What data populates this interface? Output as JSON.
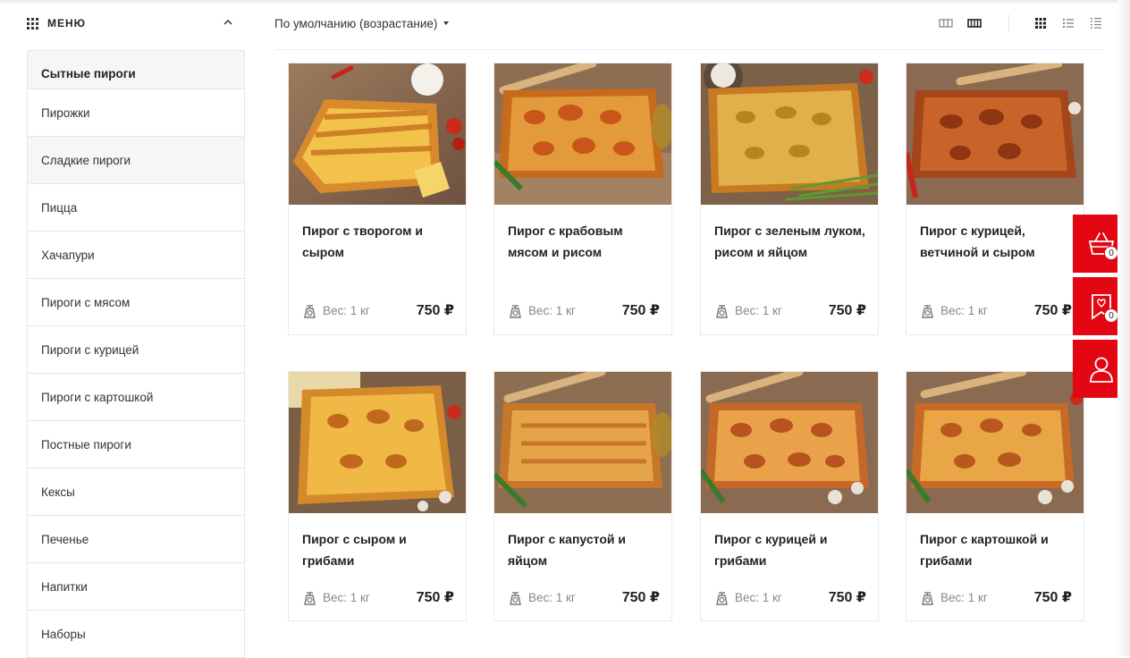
{
  "menu": {
    "title": "МЕНЮ",
    "items": [
      {
        "label": "Сытные пироги"
      },
      {
        "label": "Пирожки"
      },
      {
        "label": "Сладкие пироги"
      },
      {
        "label": "Пицца"
      },
      {
        "label": "Хачапури"
      },
      {
        "label": "Пироги с мясом"
      },
      {
        "label": "Пироги с курицей"
      },
      {
        "label": "Пироги с картошкой"
      },
      {
        "label": "Постные пироги"
      },
      {
        "label": "Кексы"
      },
      {
        "label": "Печенье"
      },
      {
        "label": "Напитки"
      },
      {
        "label": "Наборы"
      }
    ]
  },
  "toolbar": {
    "sort_label": "По умолчанию (возрастание)",
    "icons": [
      "grid-3-icon",
      "grid-4-icon",
      "tiles-icon",
      "list-icon",
      "compact-list-icon"
    ]
  },
  "products": [
    {
      "name": "Пирог с творогом и сыром",
      "weight": "Вес: 1 кг",
      "price": "750 ₽"
    },
    {
      "name": "Пирог с крабовым мясом и рисом",
      "weight": "Вес: 1 кг",
      "price": "750 ₽"
    },
    {
      "name": "Пирог с зеленым луком, рисом и яйцом",
      "weight": "Вес: 1 кг",
      "price": "750 ₽"
    },
    {
      "name": "Пирог с курицей, ветчиной и сыром",
      "weight": "Вес: 1 кг",
      "price": "750 ₽"
    },
    {
      "name": "Пирог с сыром и грибами",
      "weight": "Вес: 1 кг",
      "price": "750 ₽"
    },
    {
      "name": "Пирог с капустой и яйцом",
      "weight": "Вес: 1 кг",
      "price": "750 ₽"
    },
    {
      "name": "Пирог с курицей и грибами",
      "weight": "Вес: 1 кг",
      "price": "750 ₽"
    },
    {
      "name": "Пирог с картошкой и грибами",
      "weight": "Вес: 1 кг",
      "price": "750 ₽"
    }
  ],
  "float": {
    "cart_count": "0",
    "favorites_count": "0"
  },
  "colors": {
    "accent": "#e30613",
    "border": "#e6e6e6"
  }
}
